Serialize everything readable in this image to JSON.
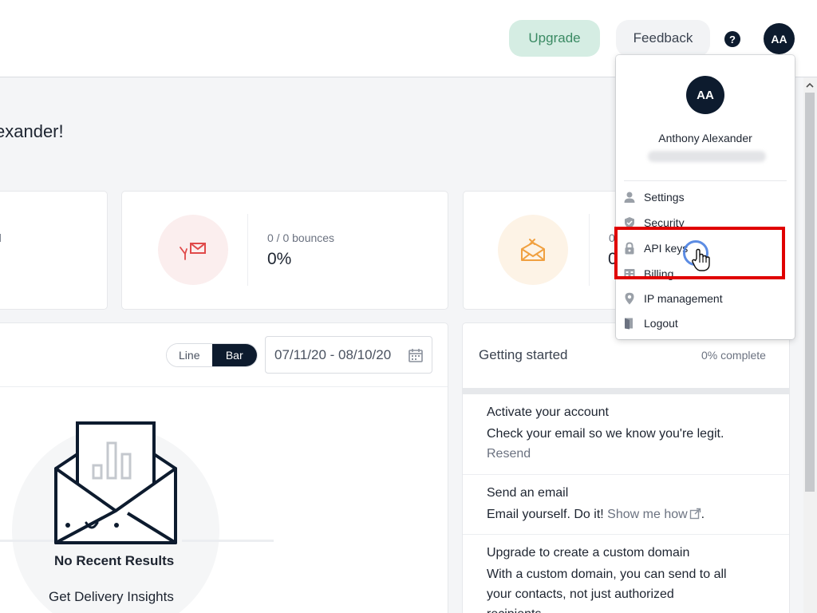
{
  "header": {
    "upgrade_label": "Upgrade",
    "feedback_label": "Feedback",
    "help_symbol": "?",
    "avatar_initials": "AA"
  },
  "greeting": {
    "visible_text": "exander!"
  },
  "stats": {
    "card1_fragment": "d",
    "bounces": {
      "label": "0 / 0 bounces",
      "value": "0%"
    },
    "spam": {
      "label": "0",
      "value": "0"
    }
  },
  "chart": {
    "toggle": {
      "line_label": "Line",
      "bar_label": "Bar",
      "selected": "Bar"
    },
    "date_range": "07/11/20 - 08/10/20",
    "empty_title": "No Recent Results",
    "empty_subtitle": "Get Delivery Insights"
  },
  "getting_started": {
    "title": "Getting started",
    "progress": "0% complete",
    "items": [
      {
        "title": "Activate your account",
        "text": "Check your email so we know you're legit.",
        "link": "Resend"
      },
      {
        "title": "Send an email",
        "text": "Email yourself. Do it!",
        "link": "Show me how",
        "suffix": "."
      },
      {
        "title": "Upgrade to create a custom domain",
        "text_line1": "With a custom domain, you can send to all",
        "text_line2": "your contacts, not just authorized",
        "text_line3": "recipients."
      }
    ]
  },
  "dropdown": {
    "avatar_initials": "AA",
    "name": "Anthony Alexander",
    "items": [
      {
        "label": "Settings",
        "icon": "user-icon"
      },
      {
        "label": "Security",
        "icon": "shield-icon"
      },
      {
        "label": "API keys",
        "icon": "lock-icon"
      },
      {
        "label": "Billing",
        "icon": "billing-icon"
      },
      {
        "label": "IP management",
        "icon": "location-pin-icon"
      },
      {
        "label": "Logout",
        "icon": "logout-icon"
      }
    ]
  },
  "colors": {
    "navy": "#0d1b2e",
    "upgrade_bg": "#d5ede3",
    "upgrade_text": "#3a8a63",
    "highlight": "#e00000",
    "bounce_accent": "#e04a4a",
    "spam_accent": "#f0a040"
  }
}
